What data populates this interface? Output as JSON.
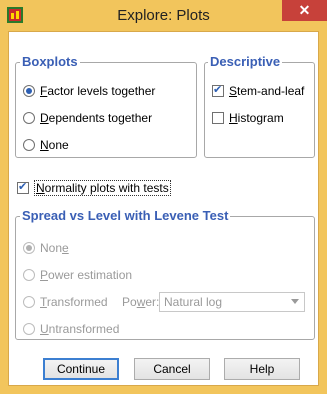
{
  "window": {
    "title": "Explore: Plots",
    "close_glyph": "✕"
  },
  "boxplots": {
    "label": "Boxplots",
    "options": [
      {
        "pre": "",
        "key": "F",
        "post": "actor levels together",
        "checked": true
      },
      {
        "pre": "",
        "key": "D",
        "post": "ependents together",
        "checked": false
      },
      {
        "pre": "",
        "key": "N",
        "post": "one",
        "checked": false
      }
    ]
  },
  "descriptive": {
    "label": "Descriptive",
    "options": [
      {
        "pre": "",
        "key": "S",
        "post": "tem-and-leaf",
        "checked": true
      },
      {
        "pre": "",
        "key": "H",
        "post": "istogram",
        "checked": false
      }
    ]
  },
  "normality": {
    "pre": "",
    "key": "N",
    "post": "ormality plots with tests",
    "checked": true
  },
  "spread": {
    "label": "Spread vs Level with Levene Test",
    "options": [
      {
        "pre": "Non",
        "key": "e",
        "post": "",
        "checked": true
      },
      {
        "pre": "",
        "key": "P",
        "post": "ower estimation",
        "checked": false
      },
      {
        "pre": "",
        "key": "T",
        "post": "ransformed",
        "checked": false
      },
      {
        "pre": "",
        "key": "U",
        "post": "ntransformed",
        "checked": false
      }
    ],
    "power_label": {
      "pre": "Po",
      "key": "w",
      "post": "er:"
    },
    "power_value": "Natural log"
  },
  "buttons": {
    "continue": "Continue",
    "cancel": "Cancel",
    "help": "Help"
  }
}
